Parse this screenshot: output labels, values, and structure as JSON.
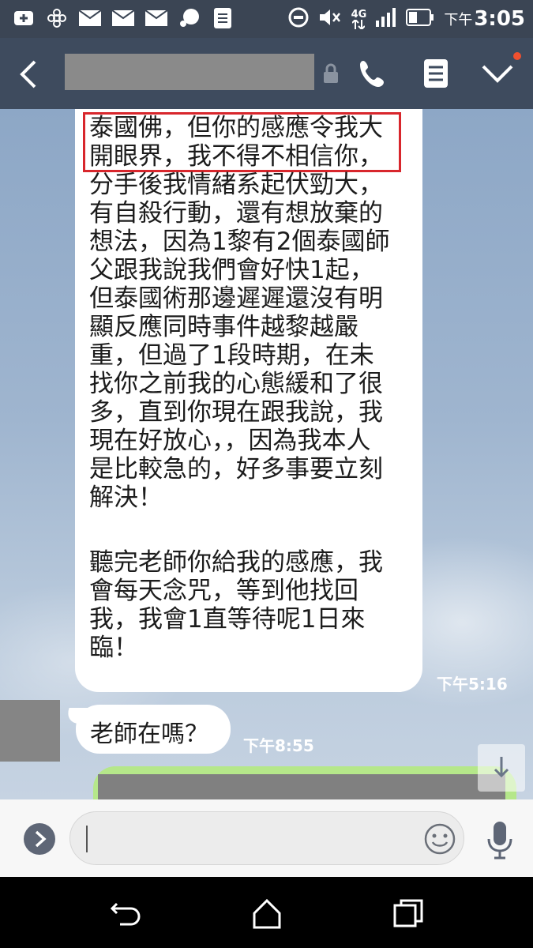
{
  "status_bar": {
    "network": "4G",
    "time_prefix": "下午",
    "time": "3:05"
  },
  "header": {
    "back_icon": "chevron-left-icon",
    "lock_icon": "lock-icon",
    "call_icon": "phone-icon",
    "notes_icon": "notes-icon",
    "menu_icon": "chevron-down-icon"
  },
  "messages": {
    "long": {
      "lines": [
        "泰國佛，但你的感應令我大",
        "開眼界，我不得不相信你，",
        "分手後我情緒系起伏勁大，",
        "有自殺行動，還有想放棄的",
        "想法，因為1黎有2個泰國師",
        "父跟我說我們會好快1起，",
        "但泰國術那邊遲遲還沒有明",
        "顯反應同時事件越黎越嚴",
        "重，但過了1段時期，在未",
        "找你之前我的心態緩和了很",
        "多，直到你現在跟我說，我",
        "現在好放心，，因為我本人",
        "是比較急的，好多事要立刻",
        "解決！",
        "",
        "聽完老師你給我的感應，我",
        "會每天念咒，等到他找回",
        "我，我會1直等待呢1日來",
        "臨！"
      ],
      "time": "下午5:16"
    },
    "short": {
      "text": "老師在嗎？",
      "time": "下午8:55"
    }
  },
  "input_bar": {
    "placeholder": ""
  },
  "colors": {
    "header_bg": "#3e4b5e",
    "highlight_border": "#d8262c",
    "sent_bubble": "#b5e78a"
  }
}
